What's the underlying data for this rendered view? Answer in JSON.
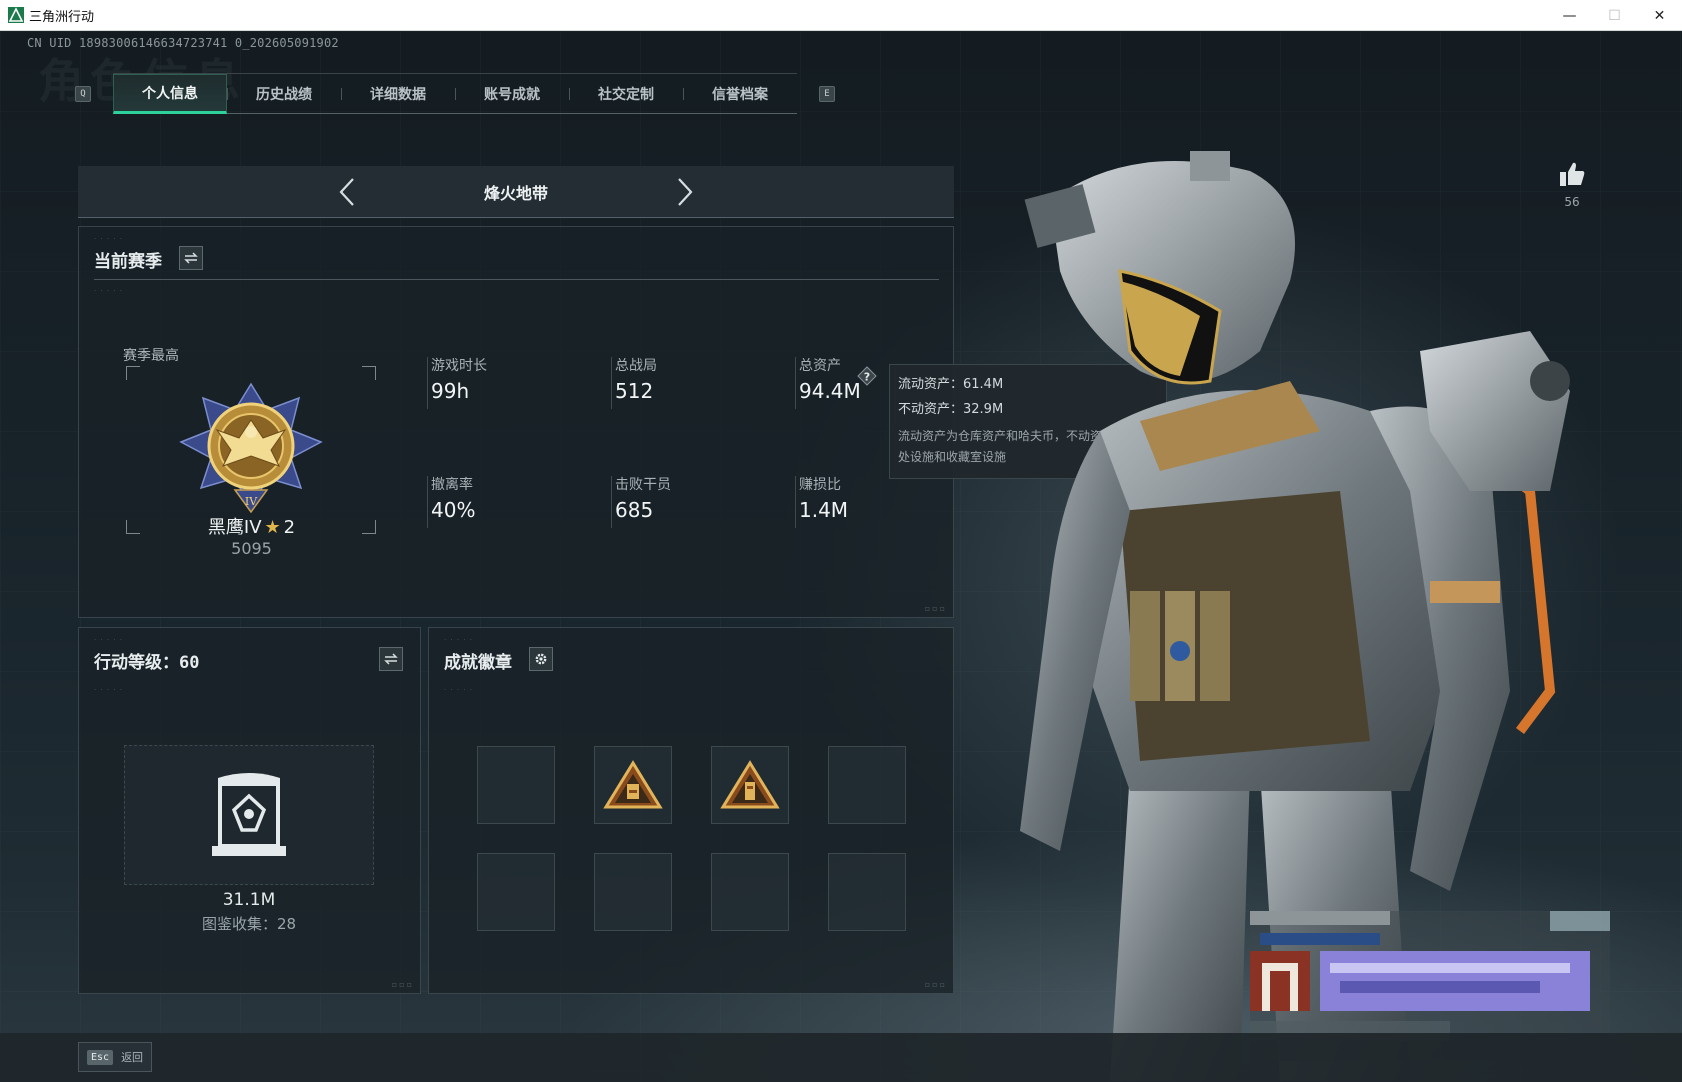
{
  "window": {
    "title": "三角洲行动",
    "controls": [
      "—",
      "☐",
      "✕"
    ]
  },
  "uid": "CN UID 18983006146634723741 0_202605091902",
  "watermark": "角色信息",
  "tabs": {
    "prev_key": "Q",
    "next_key": "E",
    "items": [
      {
        "label": "个人信息",
        "active": true
      },
      {
        "label": "历史战绩",
        "active": false
      },
      {
        "label": "详细数据",
        "active": false
      },
      {
        "label": "账号成就",
        "active": false
      },
      {
        "label": "社交定制",
        "active": false
      },
      {
        "label": "信誉档案",
        "active": false
      }
    ]
  },
  "map_selector": {
    "name": "烽火地带"
  },
  "season": {
    "title": "当前赛季",
    "best_label": "赛季最高",
    "rank_name": "黑鹰IV",
    "rank_stars": "2",
    "rank_points": "5095",
    "stats": [
      {
        "label": "游戏时长",
        "value": "99h"
      },
      {
        "label": "总战局",
        "value": "512"
      },
      {
        "label": "总资产",
        "value": "94.4M"
      },
      {
        "label": "撤离率",
        "value": "40%"
      },
      {
        "label": "击败干员",
        "value": "685"
      },
      {
        "label": "赚损比",
        "value": "1.4M"
      }
    ],
    "tooltip": {
      "liquid": "流动资产：61.4M",
      "fixed": "不动资产：32.9M",
      "description": "流动资产为仓库资产和哈夫币，不动资产为特勤处设施和收藏室设施"
    }
  },
  "level": {
    "title": "行动等级：60",
    "collection_value": "31.1M",
    "collection_count": "图鉴收集：28"
  },
  "badges": {
    "title": "成就徽章",
    "slots": [
      false,
      true,
      true,
      false,
      false,
      false,
      false,
      false
    ]
  },
  "likes": {
    "count": "56"
  },
  "footer": {
    "esc_key": "Esc",
    "back_label": "返回"
  },
  "colors": {
    "accent": "#2fd19b",
    "gold": "#e0b74d",
    "panel": "#18212700"
  }
}
